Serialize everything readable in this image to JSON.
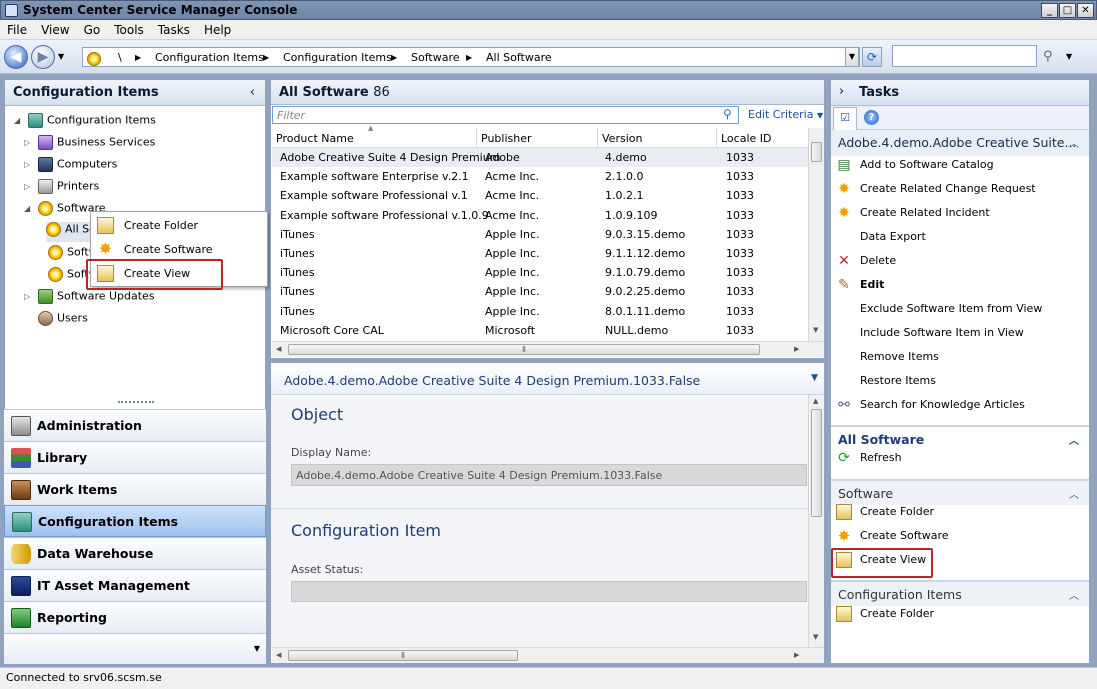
{
  "window": {
    "title": "System Center Service Manager Console"
  },
  "menu": [
    "File",
    "View",
    "Go",
    "Tools",
    "Tasks",
    "Help"
  ],
  "breadcrumb": [
    "\\",
    "Configuration Items",
    "Configuration Items",
    "Software",
    "All Software"
  ],
  "left_panel": {
    "title": "Configuration Items",
    "tree": [
      {
        "label": "Configuration Items",
        "icon": "config-items-icon"
      },
      {
        "label": "Business Services",
        "icon": "business-services-icon"
      },
      {
        "label": "Computers",
        "icon": "computers-icon"
      },
      {
        "label": "Printers",
        "icon": "printers-icon"
      },
      {
        "label": "Software",
        "icon": "software-icon"
      },
      {
        "label": "All Software",
        "icon": "view-icon"
      },
      {
        "label": "Software",
        "icon": "view-icon"
      },
      {
        "label": "Software",
        "icon": "view-icon"
      },
      {
        "label": "Software Updates",
        "icon": "software-updates-icon"
      },
      {
        "label": "Users",
        "icon": "users-icon"
      }
    ],
    "context_menu": [
      "Create Folder",
      "Create Software",
      "Create View"
    ],
    "wunderbar": [
      "Administration",
      "Library",
      "Work Items",
      "Configuration Items",
      "Data Warehouse",
      "IT Asset Management",
      "Reporting"
    ]
  },
  "center": {
    "title": "All Software",
    "count": "86",
    "filter_placeholder": "Filter",
    "edit_criteria": "Edit Criteria",
    "columns": [
      "Product Name",
      "Publisher",
      "Version",
      "Locale ID"
    ],
    "rows": [
      [
        "Adobe Creative Suite 4 Design Premium",
        "Adobe",
        "4.demo",
        "1033"
      ],
      [
        "Example software Enterprise v.2.1",
        "Acme Inc.",
        "2.1.0.0",
        "1033"
      ],
      [
        "Example software Professional v.1",
        "Acme Inc.",
        "1.0.2.1",
        "1033"
      ],
      [
        "Example software Professional v.1.0.9",
        "Acme Inc.",
        "1.0.9.109",
        "1033"
      ],
      [
        "iTunes",
        "Apple Inc.",
        "9.0.3.15.demo",
        "1033"
      ],
      [
        "iTunes",
        "Apple Inc.",
        "9.1.1.12.demo",
        "1033"
      ],
      [
        "iTunes",
        "Apple Inc.",
        "9.1.0.79.demo",
        "1033"
      ],
      [
        "iTunes",
        "Apple Inc.",
        "9.0.2.25.demo",
        "1033"
      ],
      [
        "iTunes",
        "Apple Inc.",
        "8.0.1.11.demo",
        "1033"
      ],
      [
        "Microsoft Core CAL",
        "Microsoft",
        "NULL.demo",
        "1033"
      ]
    ],
    "detail": {
      "title": "Adobe.4.demo.Adobe Creative Suite 4 Design Premium.1033.False",
      "section1": "Object",
      "display_name_label": "Display Name:",
      "display_name_value": "Adobe.4.demo.Adobe Creative Suite 4 Design Premium.1033.False",
      "section2": "Configuration Item",
      "asset_status_label": "Asset Status:",
      "asset_status_value": ""
    }
  },
  "tasks": {
    "title": "Tasks",
    "item_section": "Adobe.4.demo.Adobe Creative Suite...",
    "item_tasks": [
      "Add to Software Catalog",
      "Create Related Change Request",
      "Create Related Incident",
      "Data Export",
      "Delete",
      "Edit",
      "Exclude Software Item from View",
      "Include Software Item in View",
      "Remove Items",
      "Restore Items",
      "Search for Knowledge Articles"
    ],
    "view_section": "All Software",
    "view_tasks": [
      "Refresh"
    ],
    "software_section": "Software",
    "software_tasks": [
      "Create Folder",
      "Create Software",
      "Create View"
    ],
    "ci_section": "Configuration Items",
    "ci_tasks": [
      "Create Folder"
    ]
  },
  "status": "Connected to srv06.scsm.se",
  "colors": {
    "accent": "#1e3c78",
    "highlight_border": "#b8262a"
  }
}
